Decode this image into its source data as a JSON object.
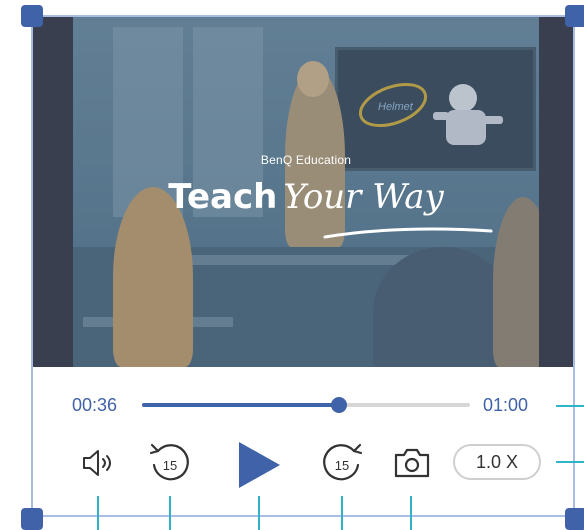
{
  "video": {
    "brand_text": "BenQ Education",
    "headline_word1": "Teach",
    "headline_word2": "Your Way",
    "board_label": "Helmet"
  },
  "player": {
    "current_time": "00:36",
    "duration": "01:00",
    "progress_fraction": 0.6,
    "rewind_seconds": "15",
    "forward_seconds": "15",
    "speed_label": "1.0 X"
  },
  "colors": {
    "accent": "#3f62a8",
    "annotation": "#2fb3c6",
    "frame": "#a9bde3"
  },
  "icons": [
    "volume-icon",
    "rewind-15-icon",
    "play-icon",
    "forward-15-icon",
    "camera-icon"
  ]
}
